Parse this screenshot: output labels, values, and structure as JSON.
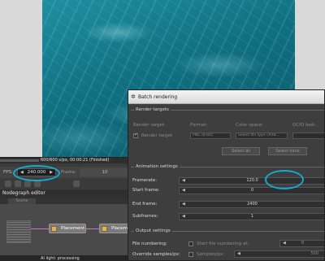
{
  "editor": {
    "status_text": "600/600 s/px, 00:00:21 (Finished)",
    "fps_label": "FPS:",
    "fps_value": "240.000",
    "fps_left_arrow": "◀",
    "fps_right_arrow": "▶",
    "frame_label": "Frame:",
    "frame_value": "10",
    "nodegraph_title": "Nodegraph editor",
    "nodegraph_tab": "Scene",
    "nodes": [
      {
        "label": "Placement"
      },
      {
        "label": "Placement"
      }
    ],
    "bottom_status": "AI light: processing"
  },
  "dialog": {
    "title": "Batch rendering",
    "sections": {
      "render_targets": "Render targets",
      "animation_settings": "Animation settings",
      "output_settings": "Output settings"
    },
    "render_targets": {
      "target_label": "Render target:",
      "format_label": "Format:",
      "colorspace_label": "Color space:",
      "ocio_label": "OCIO look:",
      "row_checkbox_label": "Render target",
      "format_value": "PNG (8-bit)",
      "colorspace_value": "Select file type (#0B...",
      "select_all": "Select all",
      "select_none": "Select none"
    },
    "animation": {
      "framerate_label": "Framerate:",
      "framerate_value": "120.0",
      "start_label": "Start frame:",
      "start_value": "0",
      "end_label": "End frame:",
      "end_value": "2400",
      "subframes_label": "Subframes:",
      "subframes_value": "1"
    },
    "output": {
      "numbering_label": "File numbering:",
      "numbering_checkbox": "Start file numbering at:",
      "numbering_value": "0",
      "override_label": "Override samples/px:",
      "override_checkbox": "Samples/px:",
      "override_value": "500"
    }
  },
  "colors": {
    "highlight_ring": "#17a7cf",
    "wire": "#d070d0",
    "node_icon": "#e0b060"
  }
}
